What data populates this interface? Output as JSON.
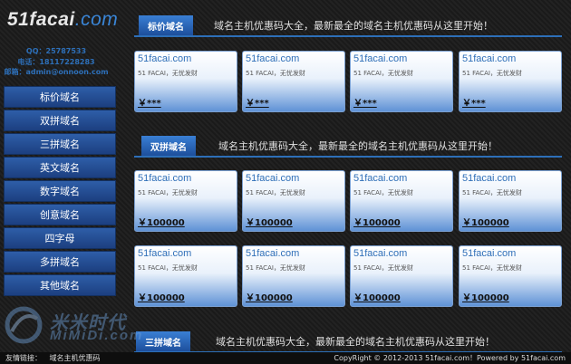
{
  "logo": {
    "main": "51facai",
    "suffix": ".com"
  },
  "contact": {
    "qq": "QQ：25787533",
    "phone": "电话：18117228283",
    "email": "邮箱：admin@onnoon.com"
  },
  "nav": {
    "items": [
      "标价域名",
      "双拼域名",
      "三拼域名",
      "英文域名",
      "数字域名",
      "创意域名",
      "四字母",
      "多拼域名",
      "其他域名"
    ]
  },
  "sections": [
    {
      "tab": "标价域名",
      "slogan": "域名主机优惠码大全，最新最全的域名主机优惠码从这里开始！"
    },
    {
      "tab": "双拼域名",
      "slogan": "域名主机优惠码大全，最新最全的域名主机优惠码从这里开始！"
    },
    {
      "tab": "三拼域名",
      "slogan": "域名主机优惠码大全，最新最全的域名主机优惠码从这里开始！"
    }
  ],
  "cards": {
    "row1": [
      {
        "domain": "51facai.com",
        "desc": "51 FACAI，无忧发财",
        "price": "￥***"
      },
      {
        "domain": "51facai.com",
        "desc": "51 FACAI，无忧发财",
        "price": "￥***"
      },
      {
        "domain": "51facai.com",
        "desc": "51 FACAI，无忧发财",
        "price": "￥***"
      },
      {
        "domain": "51facai.com",
        "desc": "51 FACAI，无忧发财",
        "price": "￥***"
      }
    ],
    "row2": [
      {
        "domain": "51facai.com",
        "desc": "51 FACAI，无忧发财",
        "price": "￥100000"
      },
      {
        "domain": "51facai.com",
        "desc": "51 FACAI，无忧发财",
        "price": "￥100000"
      },
      {
        "domain": "51facai.com",
        "desc": "51 FACAI，无忧发财",
        "price": "￥100000"
      },
      {
        "domain": "51facai.com",
        "desc": "51 FACAI，无忧发财",
        "price": "￥100000"
      }
    ],
    "row3": [
      {
        "domain": "51facai.com",
        "desc": "51 FACAI，无忧发财",
        "price": "￥100000"
      },
      {
        "domain": "51facai.com",
        "desc": "51 FACAI，无忧发财",
        "price": "￥100000"
      },
      {
        "domain": "51facai.com",
        "desc": "51 FACAI，无忧发财",
        "price": "￥100000"
      },
      {
        "domain": "51facai.com",
        "desc": "51 FACAI，无忧发财",
        "price": "￥100000"
      }
    ]
  },
  "watermark": {
    "line1": "米米时代",
    "line2": "MiMiDi.com"
  },
  "footer": {
    "links_label": "友情链接：",
    "link1": "域名主机优惠码",
    "copyright": "CopyRight © 2012-2013  51facai.com！Powered by 51facai.com"
  }
}
